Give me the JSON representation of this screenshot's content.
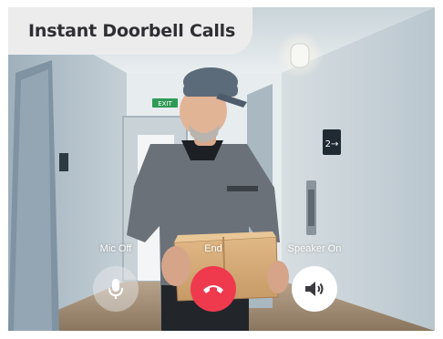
{
  "banner": {
    "title": "Instant Doorbell Calls"
  },
  "call_controls": {
    "mic": {
      "label": "Mic Off",
      "icon": "microphone-icon"
    },
    "end": {
      "label": "End",
      "icon": "hang-up-phone-icon",
      "color": "#ef3a4e"
    },
    "speaker": {
      "label": "Speaker On",
      "icon": "speaker-icon"
    }
  },
  "camera_feed": {
    "exit_sign_text": "EXIT",
    "door_number": "2→"
  }
}
